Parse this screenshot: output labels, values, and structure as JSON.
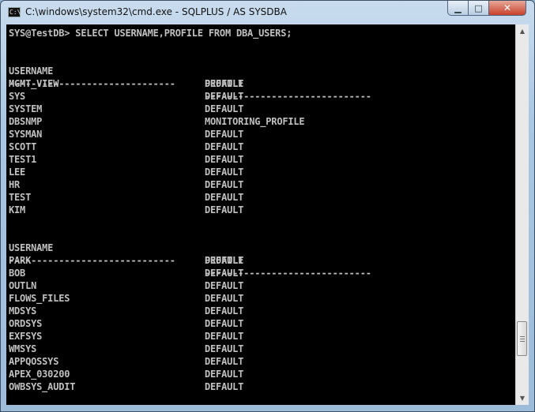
{
  "window": {
    "title": "C:\\windows\\system32\\cmd.exe - SQLPLUS  / AS SYSDBA",
    "icon_label": "C:\\",
    "controls": {
      "minimize": "minimize-icon",
      "maximize": "maximize-icon",
      "close": "close-icon"
    }
  },
  "console": {
    "prompt": "SYS@TestDB> SELECT USERNAME,PROFILE FROM DBA_USERS;",
    "header_username": "USERNAME",
    "header_profile": "PROFILE",
    "separator_username": "------------------------------",
    "separator_profile": "------------------------------",
    "page1": [
      {
        "username": "MGMT_VIEW",
        "profile": "DEFAULT"
      },
      {
        "username": "SYS",
        "profile": "DEFAULT"
      },
      {
        "username": "SYSTEM",
        "profile": "DEFAULT"
      },
      {
        "username": "DBSNMP",
        "profile": "MONITORING_PROFILE"
      },
      {
        "username": "SYSMAN",
        "profile": "DEFAULT"
      },
      {
        "username": "SCOTT",
        "profile": "DEFAULT"
      },
      {
        "username": "TEST1",
        "profile": "DEFAULT"
      },
      {
        "username": "LEE",
        "profile": "DEFAULT"
      },
      {
        "username": "HR",
        "profile": "DEFAULT"
      },
      {
        "username": "TEST",
        "profile": "DEFAULT"
      },
      {
        "username": "KIM",
        "profile": "DEFAULT"
      }
    ],
    "page2": [
      {
        "username": "PARK",
        "profile": "DEFAULT"
      },
      {
        "username": "BOB",
        "profile": "DEFAULT"
      },
      {
        "username": "OUTLN",
        "profile": "DEFAULT"
      },
      {
        "username": "FLOWS_FILES",
        "profile": "DEFAULT"
      },
      {
        "username": "MDSYS",
        "profile": "DEFAULT"
      },
      {
        "username": "ORDSYS",
        "profile": "DEFAULT"
      },
      {
        "username": "EXFSYS",
        "profile": "DEFAULT"
      },
      {
        "username": "WMSYS",
        "profile": "DEFAULT"
      },
      {
        "username": "APPQOSSYS",
        "profile": "DEFAULT"
      },
      {
        "username": "APEX_030200",
        "profile": "DEFAULT"
      },
      {
        "username": "OWBSYS_AUDIT",
        "profile": "DEFAULT"
      }
    ]
  },
  "colors": {
    "console_bg": "#000000",
    "console_fg": "#c0c0c0"
  }
}
